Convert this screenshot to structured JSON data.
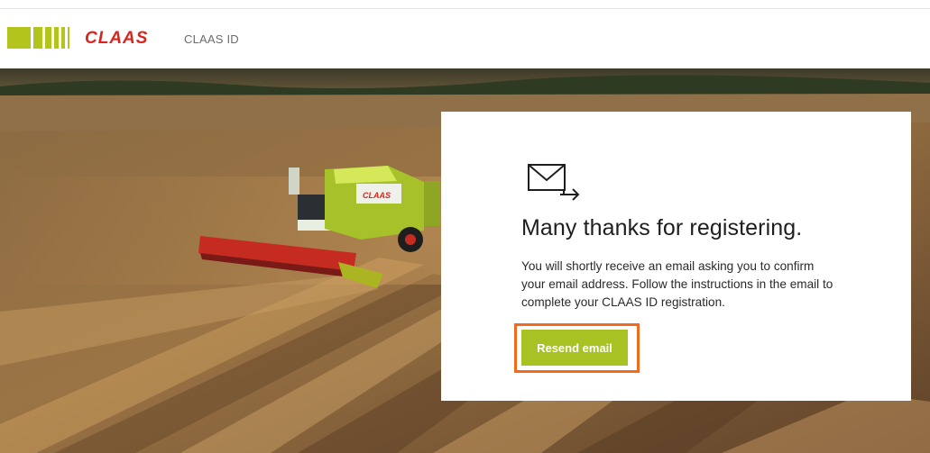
{
  "header": {
    "brand": "CLAAS",
    "app_title": "CLAAS ID"
  },
  "card": {
    "title": "Many thanks for registering.",
    "message": "You will shortly receive an email asking you to confirm your email address. Follow the instructions in the email to complete your CLAAS ID registration.",
    "resend_label": "Resend email",
    "icon": "mail-forward-icon"
  },
  "colors": {
    "brand_green": "#b3c51d",
    "brand_red": "#d8261f",
    "button_green": "#a8c224",
    "focus_orange": "#f26a1b"
  },
  "hero_image": {
    "combine_logo": "CLAAS"
  }
}
